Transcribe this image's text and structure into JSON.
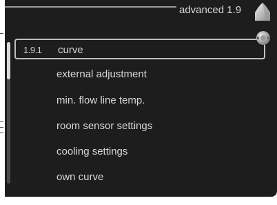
{
  "header": {
    "title": "advanced 1.9",
    "icon": "house-icon"
  },
  "menu": {
    "items": [
      {
        "number": "1.9.1",
        "label": "curve",
        "selected": true
      },
      {
        "number": "",
        "label": "external adjustment",
        "selected": false
      },
      {
        "number": "",
        "label": "min. flow line temp.",
        "selected": false
      },
      {
        "number": "",
        "label": "room sensor settings",
        "selected": false
      },
      {
        "number": "",
        "label": "cooling settings",
        "selected": false
      },
      {
        "number": "",
        "label": "own curve",
        "selected": false
      }
    ]
  },
  "colors": {
    "display_bg": "#1d1d1d",
    "text": "#d8d8d8",
    "selection_border": "#bfbfbf"
  }
}
